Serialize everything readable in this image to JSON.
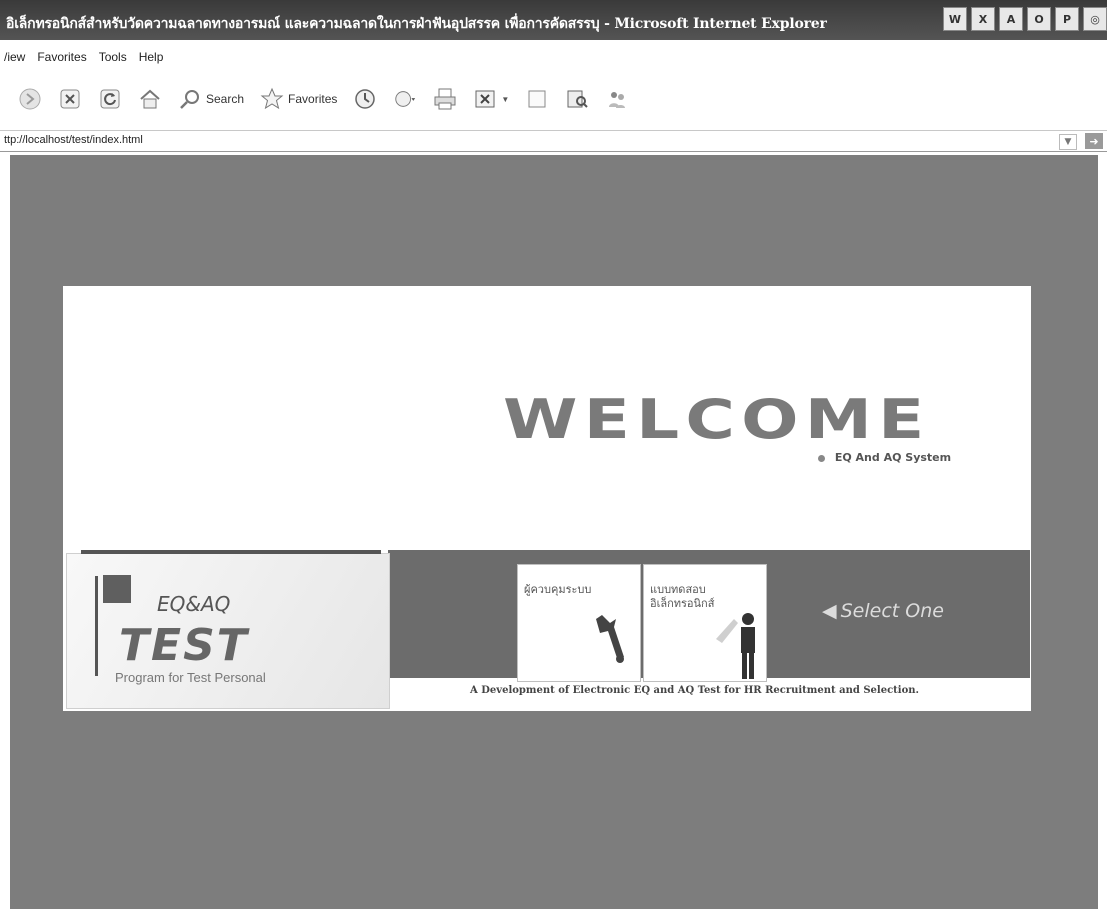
{
  "window": {
    "title": "อิเล็กทรอนิกส์สำหรับวัดความฉลาดทางอารมณ์ และความฉลาดในการฝ่าฟันอุปสรรค เพื่อการคัดสรรบุ - Microsoft Internet Explorer",
    "tray_icons": [
      "W",
      "X",
      "A",
      "O",
      "P"
    ]
  },
  "menu": {
    "items": [
      "/iew",
      "Favorites",
      "Tools",
      "Help"
    ]
  },
  "toolbar": {
    "search_label": "Search",
    "favorites_label": "Favorites"
  },
  "address": {
    "url": "ttp://localhost/test/index.html"
  },
  "page": {
    "welcome": "WELCOME",
    "subtitle": "EQ And AQ System",
    "logo_eq": "EQ&AQ",
    "logo_test": "TEST",
    "logo_sub": "Program for Test Personal",
    "card_admin": "ผู้ควบคุมระบบ",
    "card_test_line1": "แบบทดสอบ",
    "card_test_line2": "อิเล็กทรอนิกส์",
    "select_one": "Select One",
    "bottom_text": "A Development of Electronic EQ and AQ Test for HR Recruitment and Selection."
  }
}
